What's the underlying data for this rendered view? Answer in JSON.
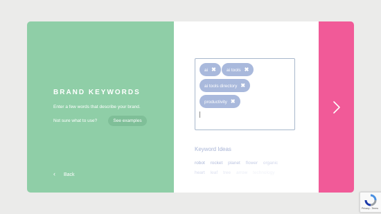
{
  "brand": {
    "title": "BRAND KEYWORDS",
    "description": "Enter a few words that describe your brand.",
    "not_sure": "Not sure what to use?",
    "see_examples": "See examples",
    "back": "Back"
  },
  "keywords": {
    "tags": [
      "ai",
      "ai tools",
      "ai tools directory",
      "productivity"
    ],
    "remove_glyph": "✖"
  },
  "ideas": {
    "title": "Keyword Ideas",
    "row1": [
      "robot",
      "rocket",
      "planet",
      "flower",
      "organic"
    ],
    "row2": [
      "heart",
      "leaf",
      "tree",
      "arrow",
      "technology"
    ]
  },
  "recaptcha": {
    "terms": "Privacy - Terms"
  },
  "colors": {
    "green_panel": "#8fcea7",
    "pink_panel": "#f15a98",
    "tag_bg": "#a9b9dc",
    "ideas_text": "#a8b4d6"
  }
}
